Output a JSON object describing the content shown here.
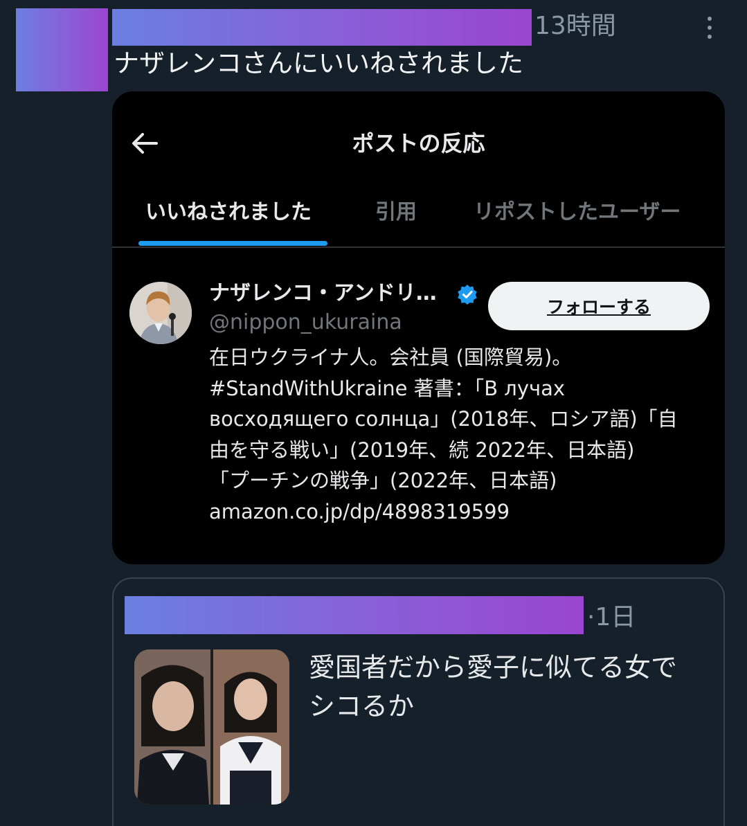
{
  "notification": {
    "time": "13時間",
    "text": "ナザレンコさんにいいねされました"
  },
  "card": {
    "title": "ポストの反応",
    "tabs": [
      "いいねされました",
      "引用",
      "リポストしたユーザー"
    ],
    "user": {
      "name": "ナザレンコ・アンドリ…",
      "handle": "@nippon_ukuraina",
      "follow_label": "フォローする",
      "bio_lines": [
        "在日ウクライナ人。会社員 (国際貿易)。",
        "#StandWithUkraine 著書：「В лучах",
        "восходящего солнца」(2018年、ロシア語)「自",
        "由を守る戦い」(2019年、続 2022年、日本語)",
        "「プーチンの戦争」(2022年、日本語)",
        "amazon.co.jp/dp/4898319599"
      ]
    }
  },
  "quote": {
    "time": "·1日",
    "text_lines": [
      "愛国者だから愛子に似てる女で",
      "シコるか"
    ]
  },
  "colors": {
    "background": "#15202b",
    "card_bg": "#000000",
    "accent": "#1d9bf0",
    "muted": "#71767b"
  },
  "icons": [
    "more-icon",
    "back-arrow-icon",
    "verified-badge-icon"
  ]
}
